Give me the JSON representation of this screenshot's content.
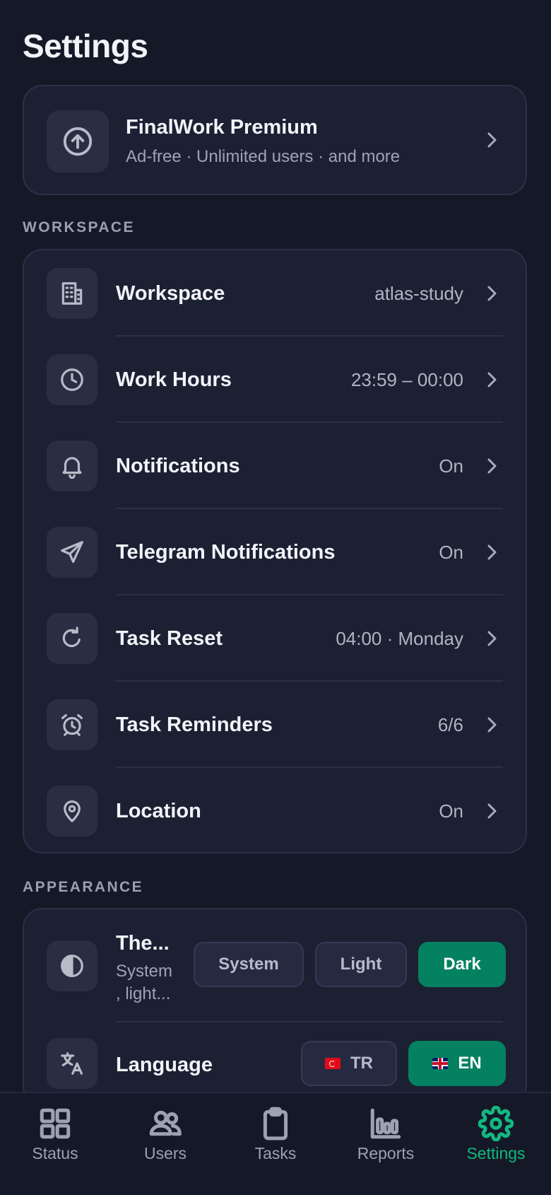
{
  "page": {
    "title": "Settings"
  },
  "premium": {
    "title": "FinalWork Premium",
    "subtitle": "Ad-free · Unlimited users · and more",
    "icon": "arrow-up-circle-icon"
  },
  "workspace_section": {
    "label": "WORKSPACE",
    "rows": [
      {
        "label": "Workspace",
        "value": "atlas-study",
        "icon": "building-icon"
      },
      {
        "label": "Work Hours",
        "value": "23:59 – 00:00",
        "icon": "clock-icon"
      },
      {
        "label": "Notifications",
        "value": "On",
        "icon": "bell-icon"
      },
      {
        "label": "Telegram Notifications",
        "value": "On",
        "icon": "send-icon"
      },
      {
        "label": "Task Reset",
        "value": "04:00 · Monday",
        "icon": "refresh-icon"
      },
      {
        "label": "Task Reminders",
        "value": "6/6",
        "icon": "alarm-clock-icon"
      },
      {
        "label": "Location",
        "value": "On",
        "icon": "map-pin-icon"
      }
    ]
  },
  "appearance_section": {
    "label": "APPEARANCE",
    "theme": {
      "title": "The...",
      "subtitle": "System , light...",
      "icon": "contrast-icon",
      "options": [
        "System",
        "Light",
        "Dark"
      ],
      "selected": "Dark"
    },
    "language": {
      "label": "Language",
      "icon": "translate-icon",
      "options": [
        "TR",
        "EN"
      ],
      "selected": "EN"
    }
  },
  "tabbar": {
    "tabs": [
      {
        "label": "Status",
        "icon": "grid-icon"
      },
      {
        "label": "Users",
        "icon": "users-icon"
      },
      {
        "label": "Tasks",
        "icon": "clipboard-icon"
      },
      {
        "label": "Reports",
        "icon": "bar-chart-icon"
      },
      {
        "label": "Settings",
        "icon": "gear-icon"
      }
    ],
    "active": "Settings"
  },
  "colors": {
    "background": "#151827",
    "card": "#1c2033",
    "accent": "#048160",
    "active_tab": "#10b981"
  }
}
